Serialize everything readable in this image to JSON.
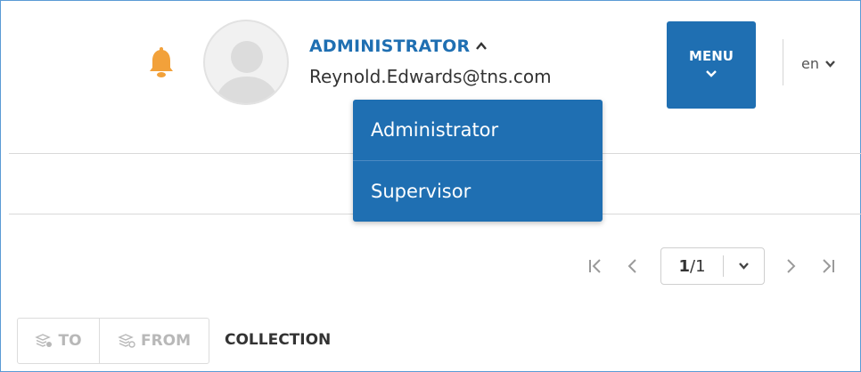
{
  "header": {
    "role": "ADMINISTRATOR",
    "email": "Reynold.Edwards@tns.com",
    "menu_label": "MENU",
    "language": "en",
    "bell_color": "#f2a13a",
    "accent_color": "#1f6fb2"
  },
  "role_dropdown": {
    "items": [
      {
        "label": "Administrator"
      },
      {
        "label": "Supervisor"
      }
    ]
  },
  "pagination": {
    "current": "1",
    "sep": "/",
    "total": "1"
  },
  "toolbar": {
    "to_label": "TO",
    "from_label": "FROM",
    "collection_label": "COLLECTION"
  }
}
